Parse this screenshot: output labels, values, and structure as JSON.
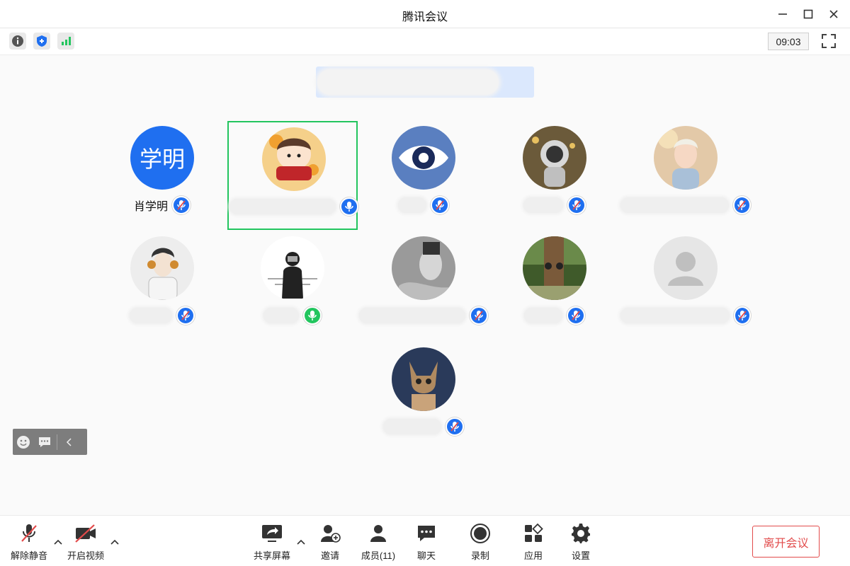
{
  "window": {
    "title": "腾讯会议"
  },
  "status": {
    "clock": "09:03",
    "icons": [
      "info-icon",
      "shield-icon",
      "signal-icon"
    ]
  },
  "colors": {
    "accent": "#1f6ff0",
    "active_border": "#22c55e",
    "leave": "#e24b4b",
    "mic_on": "#22c55e"
  },
  "participants": [
    {
      "name": "肖学明",
      "avatar_text": "学明",
      "mic": "muted",
      "active": false
    },
    {
      "name": "",
      "mic": "on",
      "active": true
    },
    {
      "name": "",
      "mic": "muted",
      "active": false
    },
    {
      "name": "",
      "mic": "muted",
      "active": false
    },
    {
      "name": "",
      "mic": "muted",
      "active": false
    },
    {
      "name": "",
      "mic": "muted",
      "active": false
    },
    {
      "name": "",
      "mic": "on",
      "active": false
    },
    {
      "name": "",
      "mic": "muted",
      "active": false
    },
    {
      "name": "",
      "mic": "muted",
      "active": false
    },
    {
      "name": "",
      "mic": "muted",
      "active": false
    },
    {
      "name": "",
      "mic": "muted",
      "active": false
    }
  ],
  "toolbar": {
    "unmute": "解除静音",
    "video": "开启视频",
    "share": "共享屏幕",
    "invite": "邀请",
    "members": "成员(11)",
    "chat": "聊天",
    "record": "录制",
    "apps": "应用",
    "settings": "设置",
    "leave": "离开会议"
  }
}
